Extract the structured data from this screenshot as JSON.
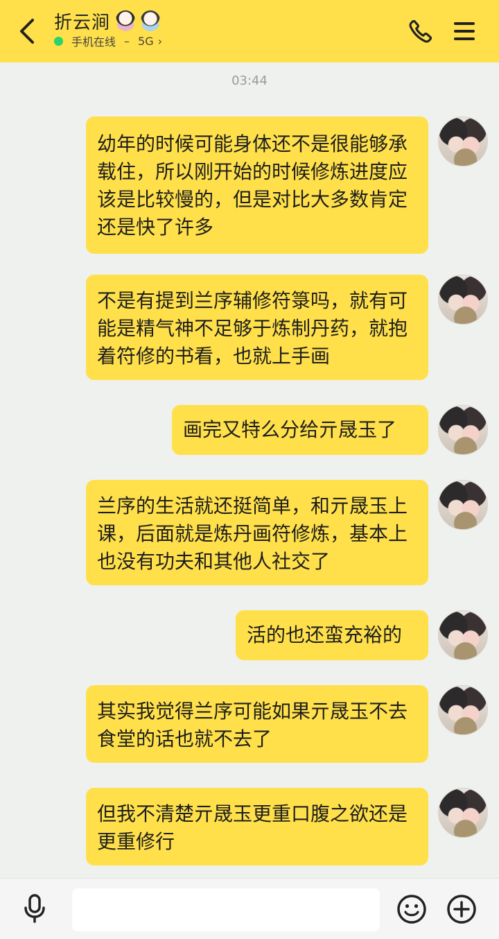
{
  "header": {
    "title": "折云涧",
    "status_text": "手机在线",
    "status_separator": "–",
    "network": "5G",
    "status_chevron": "›",
    "background_color": "#ffe04a",
    "online_color": "#27d36b",
    "icons": {
      "back": "chevron-left-icon",
      "call": "phone-icon",
      "menu": "menu-icon"
    }
  },
  "timestamp": "03:44",
  "messages": [
    {
      "text": "幼年的时候可能身体还不是很能够承载住，所以刚开始的时候修炼进度应该是比较慢的，但是对比大多数肯定还是快了许多"
    },
    {
      "text": "不是有提到兰序辅修符箓吗，就有可能是精气神不足够于炼制丹药，就抱着符修的书看，也就上手画"
    },
    {
      "text": "画完又特么分给亓晟玉了"
    },
    {
      "text": "兰序的生活就还挺简单，和亓晟玉上课，后面就是炼丹画符修炼，基本上也没有功夫和其他人社交了"
    },
    {
      "text": "活的也还蛮充裕的"
    },
    {
      "text": "其实我觉得兰序可能如果亓晟玉不去食堂的话也就不去了"
    },
    {
      "text": "但我不清楚亓晟玉更重口腹之欲还是更重修行"
    }
  ],
  "bubble_color": "#ffe04a",
  "input_bar": {
    "input_value": "",
    "icons": {
      "voice": "microphone-icon",
      "emoji": "smiley-icon",
      "more": "plus-circle-icon"
    }
  }
}
